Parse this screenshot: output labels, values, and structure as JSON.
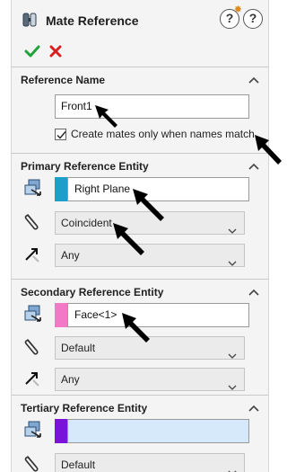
{
  "header": {
    "title": "Mate Reference",
    "help_new_label": "?",
    "help_label": "?"
  },
  "reference_name": {
    "section_title": "Reference Name",
    "value": "Front1",
    "checkbox_label": "Create mates only when names match",
    "checkbox_checked": true
  },
  "primary": {
    "section_title": "Primary Reference Entity",
    "entity": "Right Plane",
    "entity_color": "#1e9fc9",
    "mate_type": "Coincident",
    "alignment": "Any"
  },
  "secondary": {
    "section_title": "Secondary Reference Entity",
    "entity": "Face<1>",
    "entity_color": "#f279c6",
    "mate_type": "Default",
    "alignment": "Any"
  },
  "tertiary": {
    "section_title": "Tertiary Reference Entity",
    "entity": "",
    "entity_color": "#7a14d9",
    "mate_type": "Default"
  },
  "colors": {
    "ok_green": "#22a23a",
    "cancel_red": "#d62020",
    "selection_blue": "#d6e9fb"
  }
}
